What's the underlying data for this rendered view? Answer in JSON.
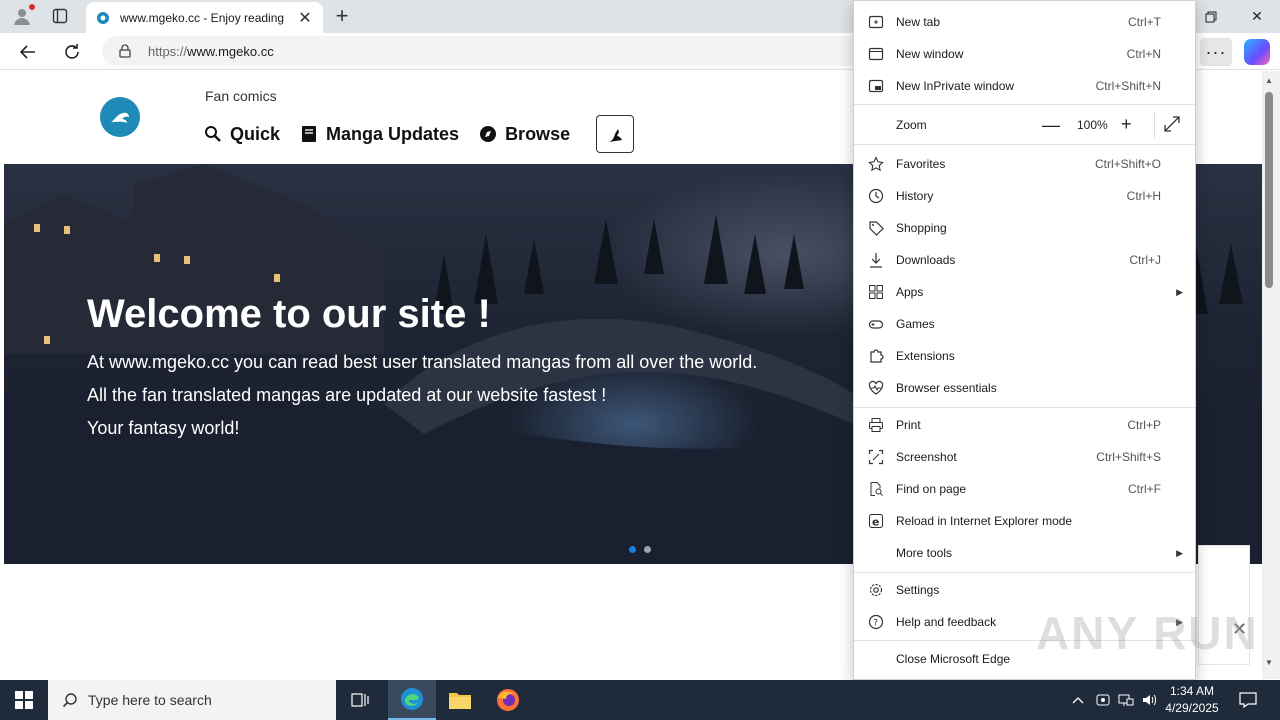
{
  "browser": {
    "tab_title": "www.mgeko.cc - Enjoy reading",
    "url_prefix": "https://",
    "url_host": "www.mgeko.cc"
  },
  "site": {
    "tagline": "Fan comics",
    "nav": [
      {
        "label": "Quick",
        "icon": "magnifier-icon"
      },
      {
        "label": "Manga Updates",
        "icon": "book-icon"
      },
      {
        "label": "Browse",
        "icon": "compass-icon"
      }
    ],
    "hero": {
      "title": "Welcome to our site !",
      "lines": [
        "At www.mgeko.cc you can read best user translated mangas from all over the world.",
        "All the fan translated mangas are updated at our website fastest !",
        "Your fantasy world!"
      ]
    }
  },
  "menu": {
    "items": [
      {
        "label": "New tab",
        "shortcut": "Ctrl+T",
        "icon": "new-tab-icon"
      },
      {
        "label": "New window",
        "shortcut": "Ctrl+N",
        "icon": "new-window-icon"
      },
      {
        "label": "New InPrivate window",
        "shortcut": "Ctrl+Shift+N",
        "icon": "inprivate-icon"
      },
      {
        "label": "Favorites",
        "shortcut": "Ctrl+Shift+O",
        "icon": "star-icon"
      },
      {
        "label": "History",
        "shortcut": "Ctrl+H",
        "icon": "history-icon"
      },
      {
        "label": "Shopping",
        "shortcut": "",
        "icon": "tag-icon"
      },
      {
        "label": "Downloads",
        "shortcut": "Ctrl+J",
        "icon": "download-icon"
      },
      {
        "label": "Apps",
        "shortcut": "",
        "icon": "apps-icon"
      },
      {
        "label": "Games",
        "shortcut": "",
        "icon": "games-icon"
      },
      {
        "label": "Extensions",
        "shortcut": "",
        "icon": "extensions-icon"
      },
      {
        "label": "Browser essentials",
        "shortcut": "",
        "icon": "heart-pulse-icon"
      },
      {
        "label": "Print",
        "shortcut": "Ctrl+P",
        "icon": "print-icon"
      },
      {
        "label": "Screenshot",
        "shortcut": "Ctrl+Shift+S",
        "icon": "screenshot-icon"
      },
      {
        "label": "Find on page",
        "shortcut": "Ctrl+F",
        "icon": "find-icon"
      },
      {
        "label": "Reload in Internet Explorer mode",
        "shortcut": "",
        "icon": "ie-icon"
      },
      {
        "label": "More tools",
        "shortcut": "",
        "icon": ""
      },
      {
        "label": "Settings",
        "shortcut": "",
        "icon": "gear-icon"
      },
      {
        "label": "Help and feedback",
        "shortcut": "",
        "icon": "help-icon"
      },
      {
        "label": "Close Microsoft Edge",
        "shortcut": "",
        "icon": ""
      }
    ],
    "zoom": {
      "label": "Zoom",
      "value": "100%"
    }
  },
  "taskbar": {
    "search_placeholder": "Type here to search",
    "time": "1:34 AM",
    "date": "4/29/2025"
  },
  "watermark": "ANY RUN",
  "colors": {
    "accent": "#0078d4",
    "taskbar": "#1f2a3a"
  }
}
